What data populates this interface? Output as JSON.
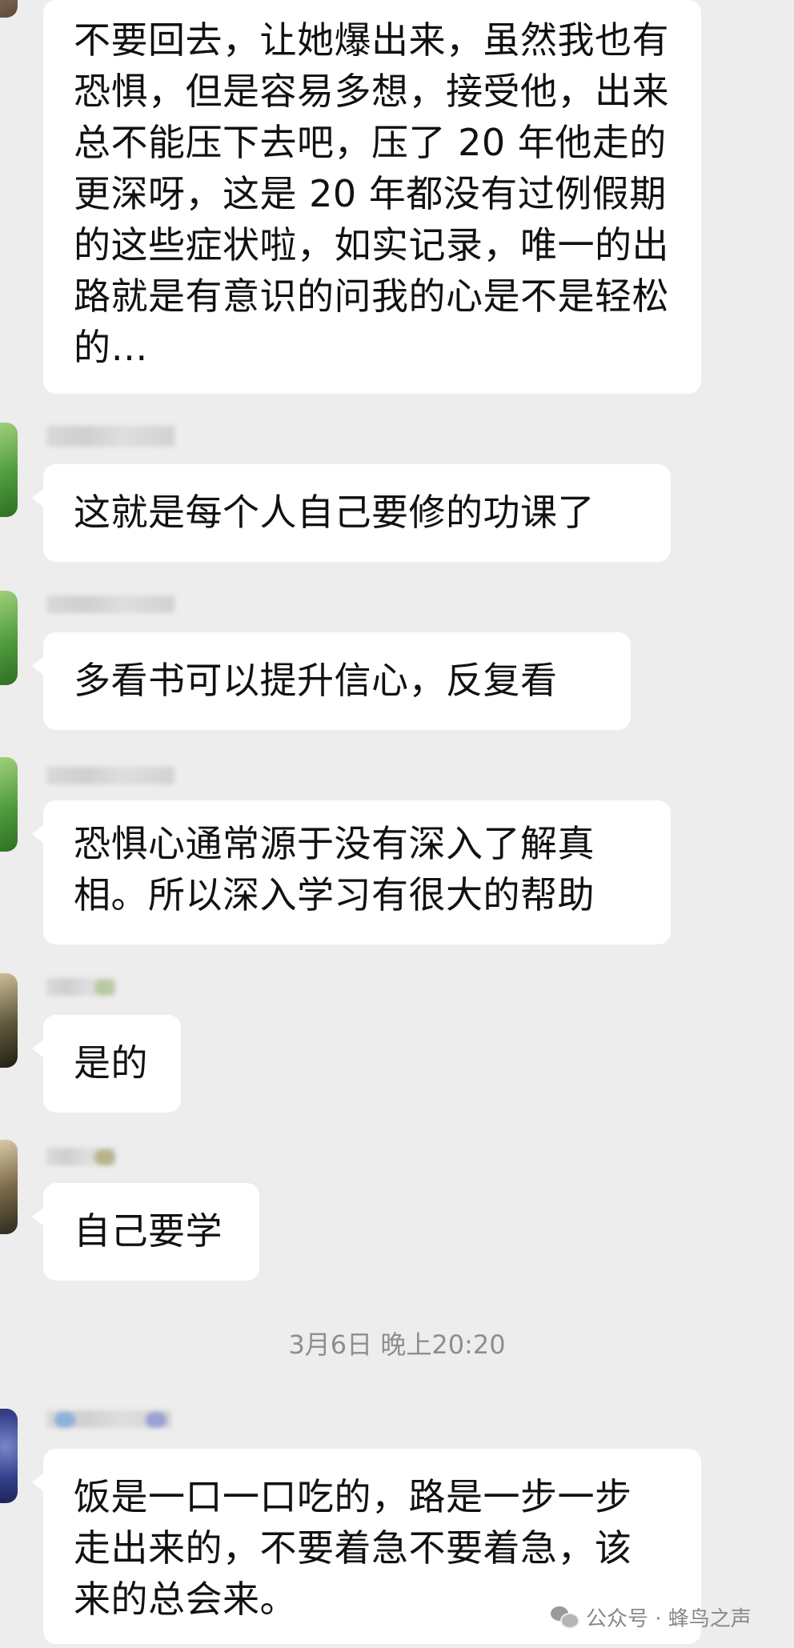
{
  "messages": [
    {
      "text": "不要回去，让她爆出来，虽然我也有恐惧，但是容易多想，接受他，出来总不能压下去吧，压了 20 年他走的更深呀，这是 20 年都没有过例假期的这些症状啦，如实记录，唯一的出路就是有意识的问我的心是不是轻松的…"
    },
    {
      "text": "这就是每个人自己要修的功课了"
    },
    {
      "text": "多看书可以提升信心，反复看"
    },
    {
      "text": "恐惧心通常源于没有深入了解真相。所以深入学习有很大的帮助"
    },
    {
      "text": "是的"
    },
    {
      "text": "自己要学"
    },
    {
      "text": "饭是一口一口吃的，路是一步一步走出来的，不要着急不要着急，该来的总会来。"
    }
  ],
  "timestamp": "3月6日 晚上20:20",
  "watermark": {
    "icon": "wechat-icon",
    "text": "公众号 · 蜂鸟之声"
  },
  "colors": {
    "background": "#ededed",
    "bubble": "#ffffff",
    "text": "#111111",
    "timestamp": "#8e8e8e"
  }
}
